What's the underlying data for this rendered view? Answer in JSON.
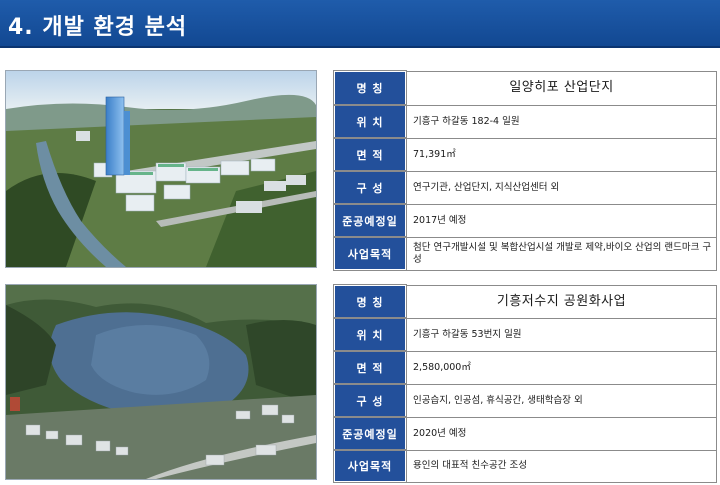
{
  "header": {
    "title": "4. 개발 환경 분석"
  },
  "labels": {
    "name": "명 칭",
    "location": "위 치",
    "area": "면 적",
    "composition": "구 성",
    "completion": "준공예정일",
    "purpose": "사업목적"
  },
  "projects": [
    {
      "name": "일양히포 산업단지",
      "location": "기흥구 하갈동 182-4 일원",
      "area": "71,391㎡",
      "composition": "연구기관, 산업단지, 지식산업센터 외",
      "completion": "2017년 예정",
      "purpose": "첨단 연구개발시설 및 복합산업시설 개발로 제약,바이오 산업의 랜드마크 구성"
    },
    {
      "name": "기흥저수지 공원화사업",
      "location": "기흥구 하갈동 53번지 일원",
      "area": "2,580,000㎡",
      "composition": "인공습지, 인공섬, 휴식공간, 생태학습장 외",
      "completion": "2020년 예정",
      "purpose": "용인의 대표적 친수공간 조성"
    }
  ],
  "colors": {
    "header": "#1a54a2",
    "label_bg": "#23509b"
  }
}
